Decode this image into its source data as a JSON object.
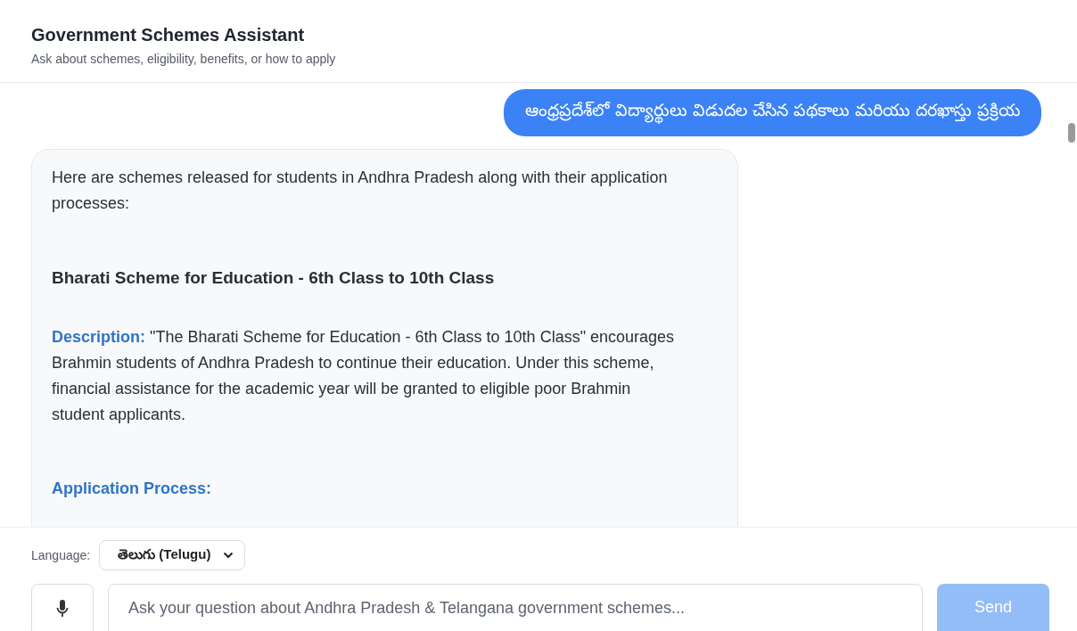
{
  "header": {
    "title": "Government Schemes Assistant",
    "subtitle": "Ask about schemes, eligibility, benefits, or how to apply"
  },
  "messages": [
    {
      "kind": "user",
      "text": "ఆంధ్రప్రదేశ్‌లో విద్యార్థులు విడుదల చేసిన పథకాలు మరియు దరఖాస్తు ప్రక్రియ"
    },
    {
      "kind": "assistant",
      "blocks": [
        {
          "kind": "paragraph",
          "text": "Here are schemes released for students in Andhra Pradesh along with their application processes:"
        },
        {
          "kind": "heading",
          "text": "Bharati Scheme for Education - 6th Class to 10th Class"
        },
        {
          "kind": "field",
          "label": "Description:",
          "text": "\"The Bharati Scheme for Education - 6th Class to 10th Class\" encourages Brahmin students of Andhra Pradesh to continue their education. Under this scheme, financial assistance for the academic year will be granted to eligible poor Brahmin student applicants."
        },
        {
          "kind": "field",
          "label": "Application Process:"
        }
      ]
    }
  ],
  "composer": {
    "language_label": "Language:",
    "language": "తెలుగు (Telugu)",
    "placeholder": "Ask your question about Andhra Pradesh & Telangana government schemes...",
    "send": {
      "label": "Send",
      "disabled": true
    }
  }
}
